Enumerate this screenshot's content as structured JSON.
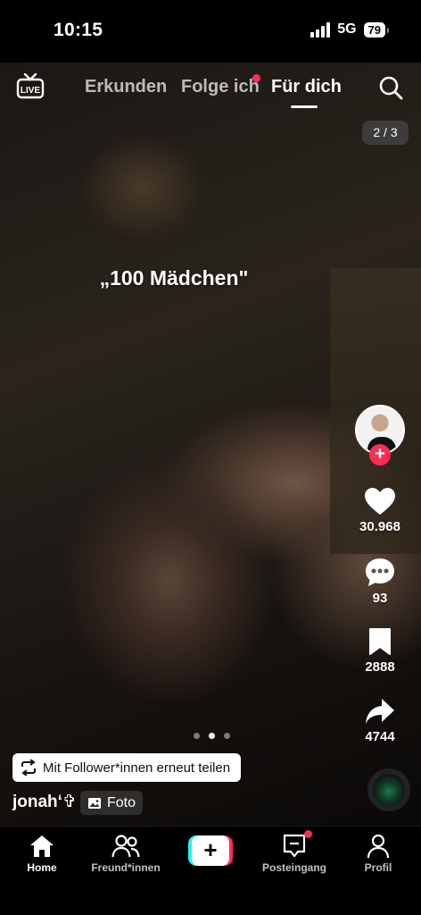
{
  "status": {
    "time": "10:15",
    "network": "5G",
    "battery": "79"
  },
  "topnav": {
    "live_label": "LIVE",
    "tabs": [
      {
        "label": "Erkunden",
        "active": false
      },
      {
        "label": "Folge ich",
        "active": false,
        "has_dot": true
      },
      {
        "label": "Für dich",
        "active": true
      }
    ]
  },
  "post": {
    "page_indicator": "2 / 3",
    "overlay_text": "„100 Mädchen\"",
    "carousel": {
      "count": 3,
      "active_index": 1
    },
    "repost_label": "Mit Follower*innen erneut teilen",
    "author": "jonah‘✞",
    "type_label": "Foto"
  },
  "rail": {
    "likes": "30.968",
    "comments": "93",
    "saves": "2888",
    "shares": "4744"
  },
  "bottombar": {
    "items": [
      {
        "label": "Home",
        "active": true
      },
      {
        "label": "Freund*innen",
        "active": false
      },
      {
        "label": "Posteingang",
        "active": false
      },
      {
        "label": "Profil",
        "active": false
      }
    ]
  },
  "colors": {
    "accent": "#fe2c55",
    "cyan": "#25f4ee",
    "background": "#000000"
  }
}
